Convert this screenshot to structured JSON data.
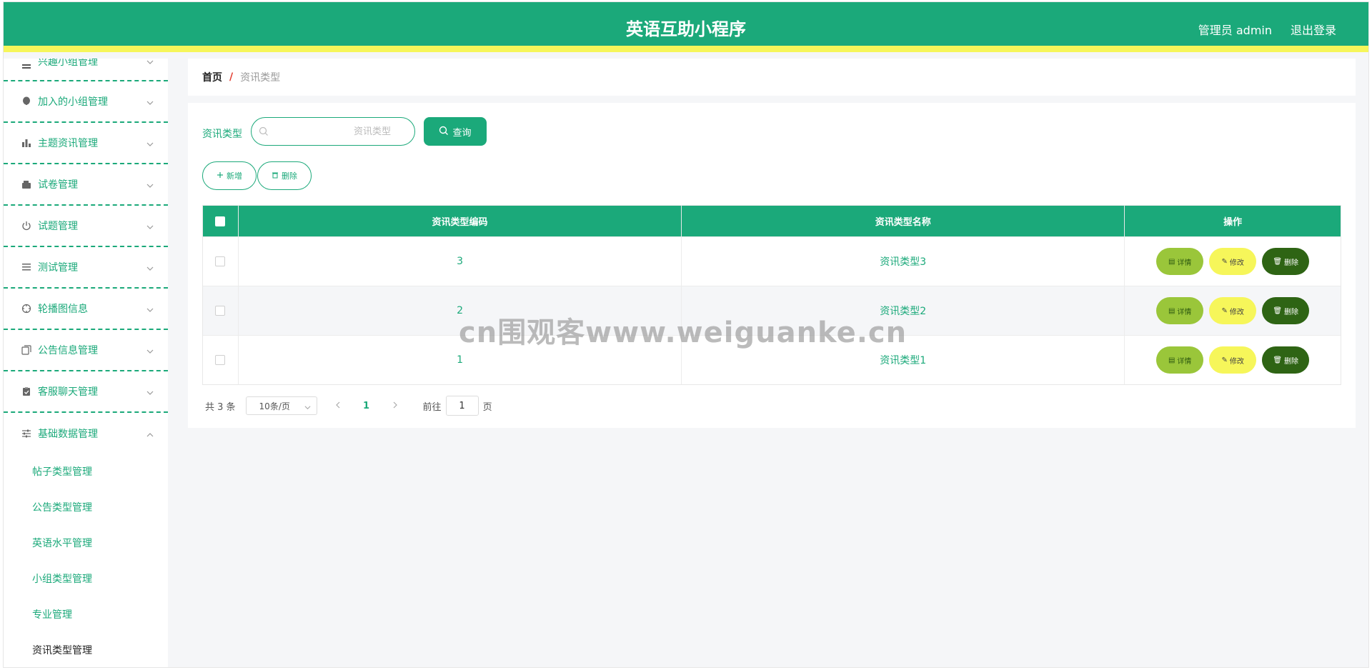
{
  "header": {
    "title": "英语互助小程序",
    "user": "管理员 admin",
    "logout": "退出登录"
  },
  "sidebar": {
    "items": [
      {
        "label": "兴趣小组管理",
        "icon": "list-icon"
      },
      {
        "label": "加入的小组管理",
        "icon": "balloon-icon"
      },
      {
        "label": "主题资讯管理",
        "icon": "bar-chart-icon"
      },
      {
        "label": "试卷管理",
        "icon": "wallet-icon"
      },
      {
        "label": "试题管理",
        "icon": "power-icon"
      },
      {
        "label": "测试管理",
        "icon": "menu-lines-icon"
      },
      {
        "label": "轮播图信息",
        "icon": "crosshair-icon"
      },
      {
        "label": "公告信息管理",
        "icon": "copy-icon"
      },
      {
        "label": "客服聊天管理",
        "icon": "clipboard-icon"
      },
      {
        "label": "基础数据管理",
        "icon": "sliders-icon"
      }
    ],
    "subitems": [
      "帖子类型管理",
      "公告类型管理",
      "英语水平管理",
      "小组类型管理",
      "专业管理",
      "资讯类型管理"
    ]
  },
  "breadcrumb": {
    "home": "首页",
    "separator": "/",
    "current": "资讯类型"
  },
  "search": {
    "label": "资讯类型",
    "placeholder": "资讯类型",
    "button": "查询"
  },
  "actions": {
    "add": "新增",
    "delete": "删除"
  },
  "table": {
    "headers": [
      "资讯类型编码",
      "资讯类型名称",
      "操作"
    ],
    "rows": [
      {
        "code": "3",
        "name": "资讯类型3"
      },
      {
        "code": "2",
        "name": "资讯类型2"
      },
      {
        "code": "1",
        "name": "资讯类型1"
      }
    ],
    "ops": {
      "detail": "详情",
      "edit": "修改",
      "delete": "删除"
    }
  },
  "pagination": {
    "total": "共 3 条",
    "page_size": "10条/页",
    "current_page": "1",
    "goto_label": "前往",
    "goto_value": "1",
    "page_suffix": "页"
  },
  "watermark": "cn围观客www.weiguanke.cn",
  "colors": {
    "primary": "#1ba97a",
    "accent_yellow": "#f6f65a",
    "detail_green": "#9ac63a",
    "delete_dark": "#2e6414",
    "breadcrumb_separator": "#e23b2e"
  }
}
